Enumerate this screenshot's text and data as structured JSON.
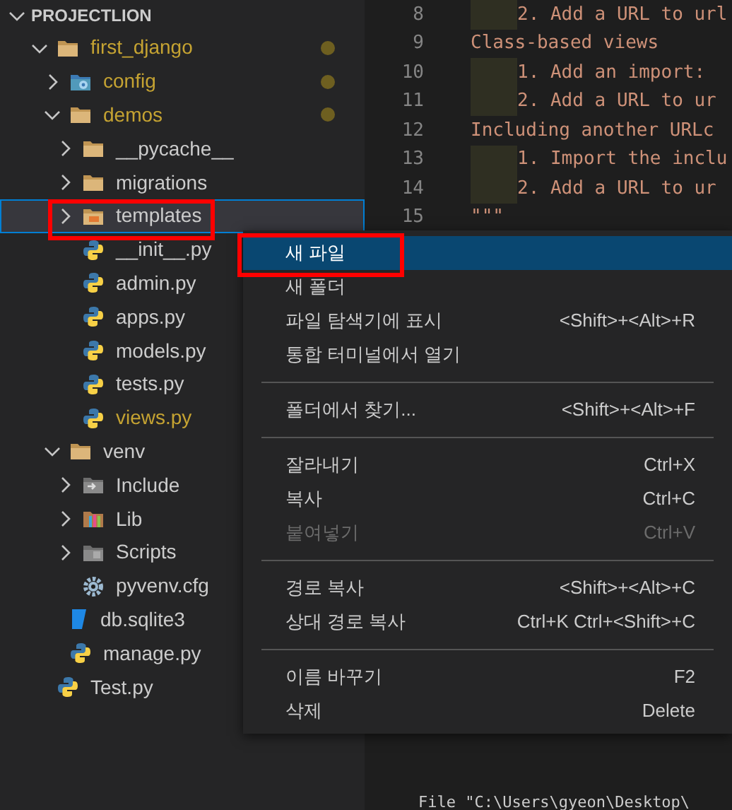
{
  "explorer": {
    "title": "PROJECTLION",
    "expanded": true,
    "tree": [
      {
        "name": "first_django",
        "kind": "folder",
        "expanded": true,
        "modified": true,
        "selected": false,
        "children": [
          {
            "name": "config",
            "kind": "config-folder",
            "expanded": false,
            "modified": true,
            "selected": false
          },
          {
            "name": "demos",
            "kind": "folder",
            "expanded": true,
            "modified": true,
            "selected": false,
            "children": [
              {
                "name": "__pycache__",
                "kind": "folder",
                "expanded": false,
                "modified": false,
                "selected": false
              },
              {
                "name": "migrations",
                "kind": "folder",
                "expanded": false,
                "modified": false,
                "selected": false
              },
              {
                "name": "templates",
                "kind": "template-folder",
                "expanded": false,
                "modified": false,
                "selected": true
              },
              {
                "name": "__init__.py",
                "kind": "python",
                "modified": false,
                "selected": false
              },
              {
                "name": "admin.py",
                "kind": "python",
                "modified": false,
                "selected": false
              },
              {
                "name": "apps.py",
                "kind": "python",
                "modified": false,
                "selected": false
              },
              {
                "name": "models.py",
                "kind": "python",
                "modified": false,
                "selected": false
              },
              {
                "name": "tests.py",
                "kind": "python",
                "modified": false,
                "selected": false
              },
              {
                "name": "views.py",
                "kind": "python",
                "modified": true,
                "selected": false
              }
            ]
          },
          {
            "name": "venv",
            "kind": "folder",
            "expanded": true,
            "modified": false,
            "selected": false,
            "children": [
              {
                "name": "Include",
                "kind": "include-folder",
                "expanded": false,
                "modified": false,
                "selected": false
              },
              {
                "name": "Lib",
                "kind": "lib-folder",
                "expanded": false,
                "modified": false,
                "selected": false
              },
              {
                "name": "Scripts",
                "kind": "scripts-folder",
                "expanded": false,
                "modified": false,
                "selected": false
              },
              {
                "name": "pyvenv.cfg",
                "kind": "settings",
                "modified": false,
                "selected": false
              }
            ]
          },
          {
            "name": "db.sqlite3",
            "kind": "database",
            "modified": false,
            "selected": false
          },
          {
            "name": "manage.py",
            "kind": "python",
            "modified": false,
            "selected": false
          }
        ]
      },
      {
        "name": "Test.py",
        "kind": "python",
        "modified": false,
        "selected": false
      }
    ]
  },
  "editor": {
    "lines": [
      {
        "number": "8",
        "indent": true,
        "text": "2. Add a URL to url"
      },
      {
        "number": "9",
        "indent": false,
        "text": "Class-based views"
      },
      {
        "number": "10",
        "indent": true,
        "text": "1. Add an import:"
      },
      {
        "number": "11",
        "indent": true,
        "text": "2. Add a URL to ur"
      },
      {
        "number": "12",
        "indent": false,
        "text": "Including another URLc"
      },
      {
        "number": "13",
        "indent": true,
        "text": "1. Import the inclu"
      },
      {
        "number": "14",
        "indent": true,
        "text": "2. Add a URL to ur"
      },
      {
        "number": "15",
        "indent": false,
        "text": "\"\"\""
      }
    ],
    "bottom_text": "File \"C:\\Users\\gyeon\\Desktop\\"
  },
  "context_menu": {
    "groups": [
      [
        {
          "label": "새 파일",
          "selected": true,
          "disabled": false
        },
        {
          "label": "새 폴더",
          "selected": false,
          "disabled": false
        },
        {
          "label": "파일 탐색기에 표시",
          "shortcut": "<Shift>+<Alt>+R",
          "selected": false,
          "disabled": false
        },
        {
          "label": "통합 터미널에서 열기",
          "selected": false,
          "disabled": false
        }
      ],
      [
        {
          "label": "폴더에서 찾기...",
          "shortcut": "<Shift>+<Alt>+F",
          "selected": false,
          "disabled": false
        }
      ],
      [
        {
          "label": "잘라내기",
          "shortcut": "Ctrl+X",
          "selected": false,
          "disabled": false
        },
        {
          "label": "복사",
          "shortcut": "Ctrl+C",
          "selected": false,
          "disabled": false
        },
        {
          "label": "붙여넣기",
          "shortcut": "Ctrl+V",
          "selected": false,
          "disabled": true
        }
      ],
      [
        {
          "label": "경로 복사",
          "shortcut": "<Shift>+<Alt>+C",
          "selected": false,
          "disabled": false
        },
        {
          "label": "상대 경로 복사",
          "shortcut": "Ctrl+K Ctrl+<Shift>+C",
          "selected": false,
          "disabled": false
        }
      ],
      [
        {
          "label": "이름 바꾸기",
          "shortcut": "F2",
          "selected": false,
          "disabled": false
        },
        {
          "label": "삭제",
          "shortcut": "Delete",
          "selected": false,
          "disabled": false
        }
      ]
    ]
  }
}
